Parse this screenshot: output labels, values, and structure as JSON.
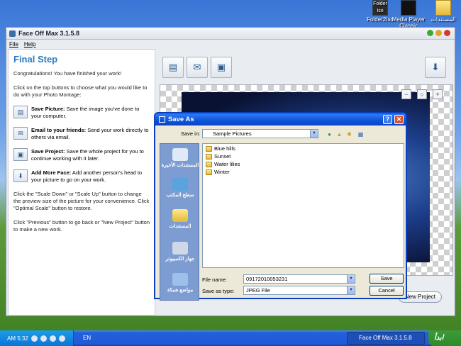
{
  "desktop": {
    "icons": [
      {
        "label": "Folder2Iso",
        "glyph_text": "Folder Iso"
      },
      {
        "label": "Media Player Classic",
        "glyph_text": ""
      },
      {
        "label": "المستندات",
        "glyph_text": ""
      }
    ]
  },
  "app": {
    "title": "Face Off Max  3.1.5.8",
    "menu": [
      "File",
      "Help"
    ],
    "left": {
      "heading": "Final Step",
      "intro": "Congratulations! You have finished your work!",
      "instructions": "Click on the top buttons to choose what you would like to do with your Photo Montage:",
      "items": [
        {
          "bold": "Save Picture:",
          "text": " Save the image you've done to your computer.",
          "icon": "save-picture-icon"
        },
        {
          "bold": "Email to your friends:",
          "text": " Send your work directly to others via email.",
          "icon": "email-icon"
        },
        {
          "bold": "Save Project:",
          "text": " Save the whole project for you to continue working with it later.",
          "icon": "save-project-icon"
        },
        {
          "bold": "Add More Face:",
          "text": " Add another person's head to your picture to go on your work.",
          "icon": "add-face-icon"
        }
      ],
      "scale_help": "Click the \"Scale Down\" or \"Scale Up\" button to change the preview size of the picture for your convenience. Click \"Optimal Scale\" button to restore.",
      "nav_help": "Click \"Previous\" button to go back or \"New Project\" button to make a new work."
    },
    "new_project_label": "New Project"
  },
  "dialog": {
    "title": "Save As",
    "save_in_label": "Save in:",
    "save_in_value": "Sample Pictures",
    "places": [
      "المستندات الأخيرة",
      "سطح المكتب",
      "المستندات",
      "جهاز الكمبيوتر",
      "مواضع شبكة"
    ],
    "files": [
      "Blue hills",
      "Sunset",
      "Water lilies",
      "Winter"
    ],
    "file_name_label": "File name:",
    "file_name_value": "09172010053231",
    "save_as_type_label": "Save as type:",
    "save_as_type_value": "JPEG File",
    "save_button": "Save",
    "cancel_button": "Cancel"
  },
  "taskbar": {
    "clock": "AM 5:32",
    "language": "EN",
    "task_item": "Face Off Max  3.1.5.8",
    "start_label": "ابدأ"
  }
}
